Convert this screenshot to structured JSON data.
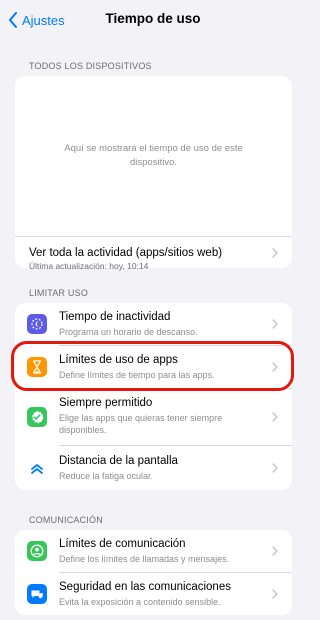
{
  "nav": {
    "back_label": "Ajustes",
    "title": "Tiempo de uso"
  },
  "all_devices": {
    "header": "TODOS LOS DISPOSITIVOS",
    "placeholder": "Aquí se mostrará el tiempo de uso de este dispositivo.",
    "activity_label": "Ver toda la actividad (apps/sitios web)",
    "last_update": "Última actualización: hoy, 10:14"
  },
  "limit": {
    "header": "LIMITAR USO",
    "items": [
      {
        "title": "Tiempo de inactividad",
        "subtitle": "Programa un horario de descanso.",
        "icon": "downtime-moon-icon",
        "color": "#5e5ce6"
      },
      {
        "title": "Límites de uso de apps",
        "subtitle": "Define límites de tiempo para las apps.",
        "icon": "hourglass-icon",
        "color": "#ff9500"
      },
      {
        "title": "Siempre permitido",
        "subtitle": "Elige las apps que quieras tener siempre disponibles.",
        "icon": "checkmark-seal-icon",
        "color": "#34c759"
      },
      {
        "title": "Distancia de la pantalla",
        "subtitle": "Reduce la fatiga ocular.",
        "icon": "chevrons-up-icon",
        "color": "#007aff"
      }
    ]
  },
  "communication": {
    "header": "COMUNICACIÓN",
    "items": [
      {
        "title": "Límites de comunicación",
        "subtitle": "Define los límites de llamadas y mensajes.",
        "icon": "person-circle-icon",
        "color": "#34c759"
      },
      {
        "title": "Seguridad en las comunicaciones",
        "subtitle": "Evita la exposición a contenido sensible.",
        "icon": "message-shield-icon",
        "color": "#007aff"
      }
    ]
  },
  "colors": {
    "accent": "#007aff",
    "highlight": "#e3180f",
    "background": "#f2f2f7"
  }
}
